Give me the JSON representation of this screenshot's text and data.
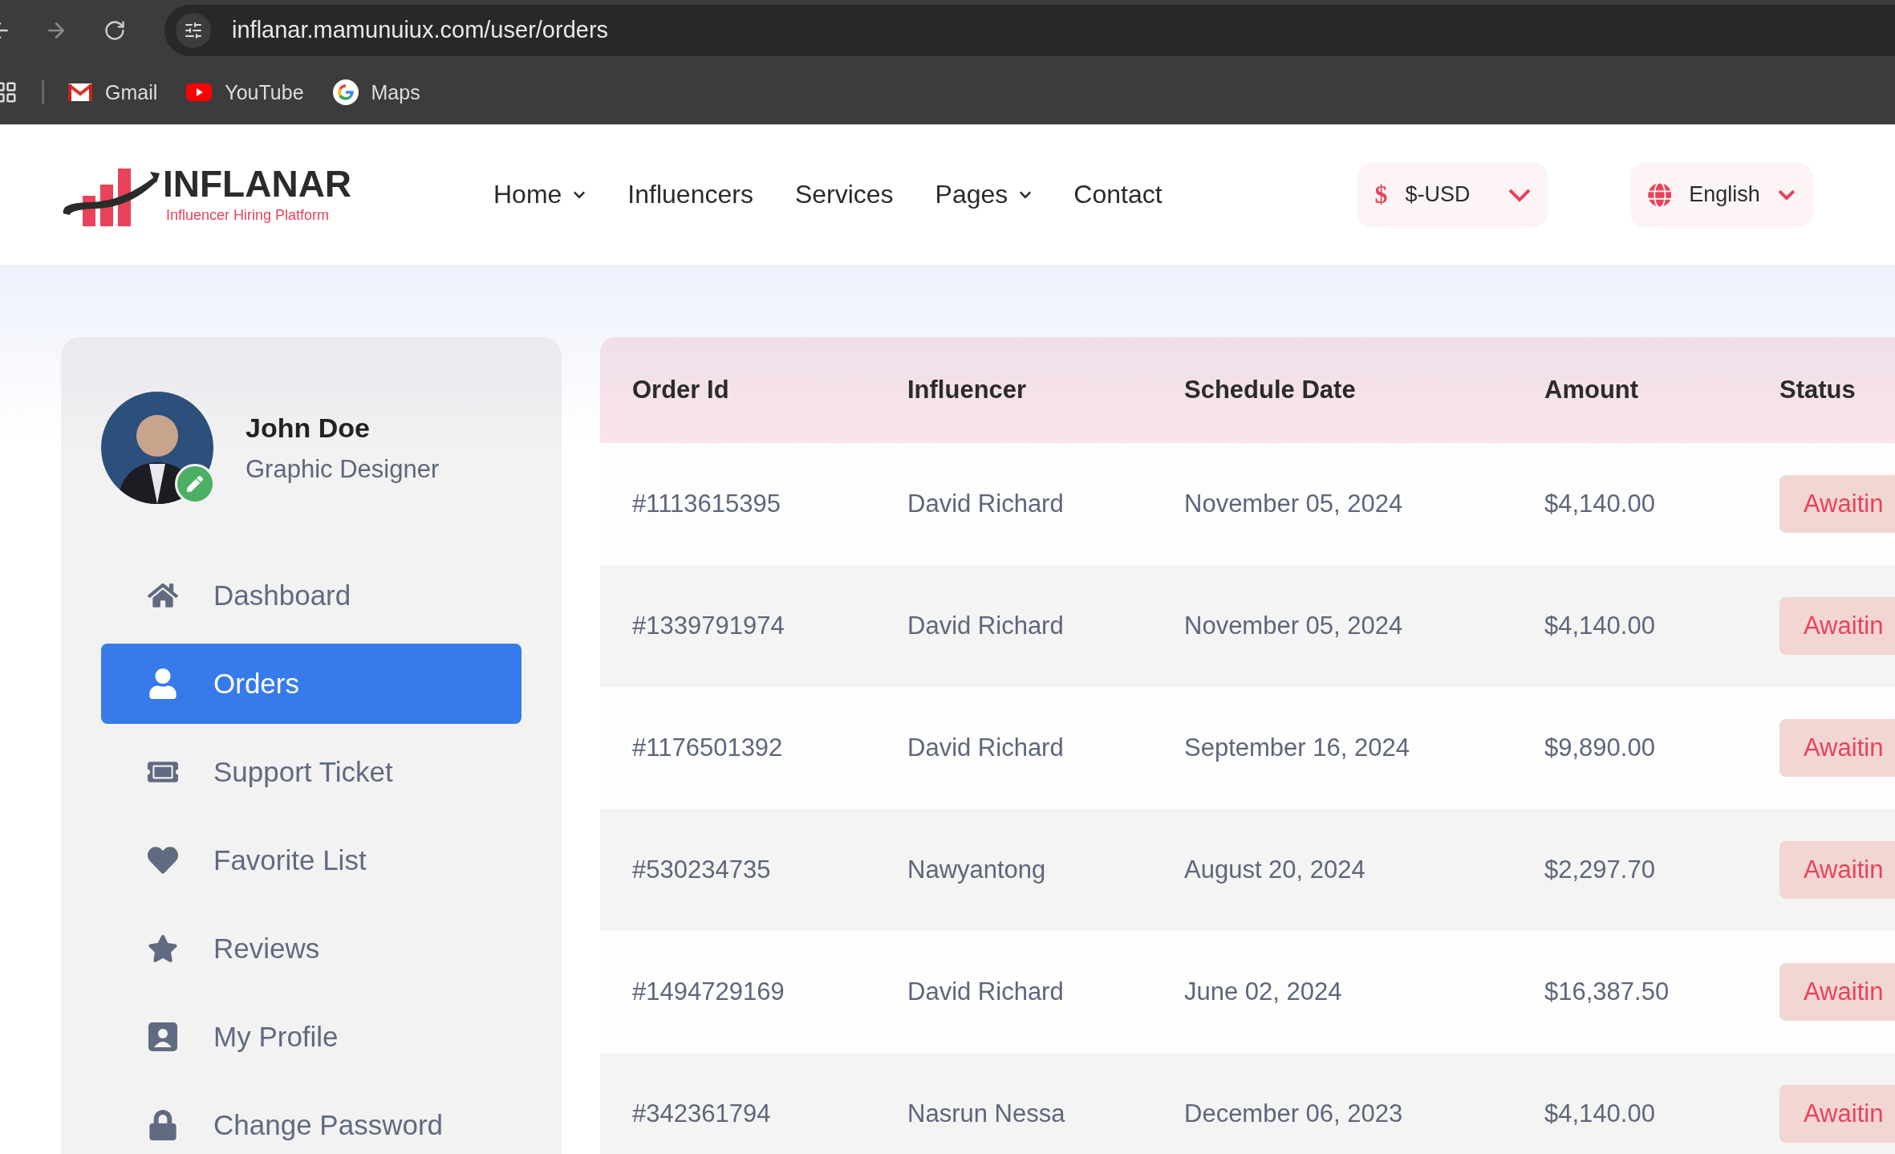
{
  "browser": {
    "url": "inflanar.mamunuiux.com/user/orders",
    "bookmarks": [
      {
        "label": "Gmail",
        "kind": "gmail"
      },
      {
        "label": "YouTube",
        "kind": "youtube"
      },
      {
        "label": "Maps",
        "kind": "google"
      }
    ]
  },
  "header": {
    "logo": {
      "name": "INFLANAR",
      "tagline": "Influencer Hiring Platform"
    },
    "nav": [
      {
        "label": "Home",
        "dropdown": true
      },
      {
        "label": "Influencers",
        "dropdown": false
      },
      {
        "label": "Services",
        "dropdown": false
      },
      {
        "label": "Pages",
        "dropdown": true
      },
      {
        "label": "Contact",
        "dropdown": false
      }
    ],
    "currency": {
      "symbol": "$",
      "label": "$-USD"
    },
    "language": {
      "label": "English"
    }
  },
  "profile": {
    "name": "John Doe",
    "role": "Graphic Designer"
  },
  "sidebar": {
    "items": [
      {
        "label": "Dashboard",
        "kind": "home",
        "selected": false
      },
      {
        "label": "Orders",
        "kind": "user",
        "selected": true
      },
      {
        "label": "Support Ticket",
        "kind": "ticket",
        "selected": false
      },
      {
        "label": "Favorite List",
        "kind": "heart",
        "selected": false
      },
      {
        "label": "Reviews",
        "kind": "star",
        "selected": false
      },
      {
        "label": "My Profile",
        "kind": "profile",
        "selected": false
      },
      {
        "label": "Change Password",
        "kind": "lock",
        "selected": false
      }
    ]
  },
  "table": {
    "columns": [
      "Order Id",
      "Influencer",
      "Schedule Date",
      "Amount",
      "Status"
    ],
    "rows": [
      {
        "order_id": "#1113615395",
        "influencer": "David Richard",
        "date": "November 05, 2024",
        "amount": "$4,140.00",
        "status": "Awaitin"
      },
      {
        "order_id": "#1339791974",
        "influencer": "David Richard",
        "date": "November 05, 2024",
        "amount": "$4,140.00",
        "status": "Awaitin"
      },
      {
        "order_id": "#1176501392",
        "influencer": "David Richard",
        "date": "September 16, 2024",
        "amount": "$9,890.00",
        "status": "Awaitin"
      },
      {
        "order_id": "#530234735",
        "influencer": "Nawyantong",
        "date": "August 20, 2024",
        "amount": "$2,297.70",
        "status": "Awaitin"
      },
      {
        "order_id": "#1494729169",
        "influencer": "David Richard",
        "date": "June 02, 2024",
        "amount": "$16,387.50",
        "status": "Awaitin"
      },
      {
        "order_id": "#342361794",
        "influencer": "Nasrun Nessa",
        "date": "December 06, 2023",
        "amount": "$4,140.00",
        "status": "Awaitin"
      }
    ]
  }
}
